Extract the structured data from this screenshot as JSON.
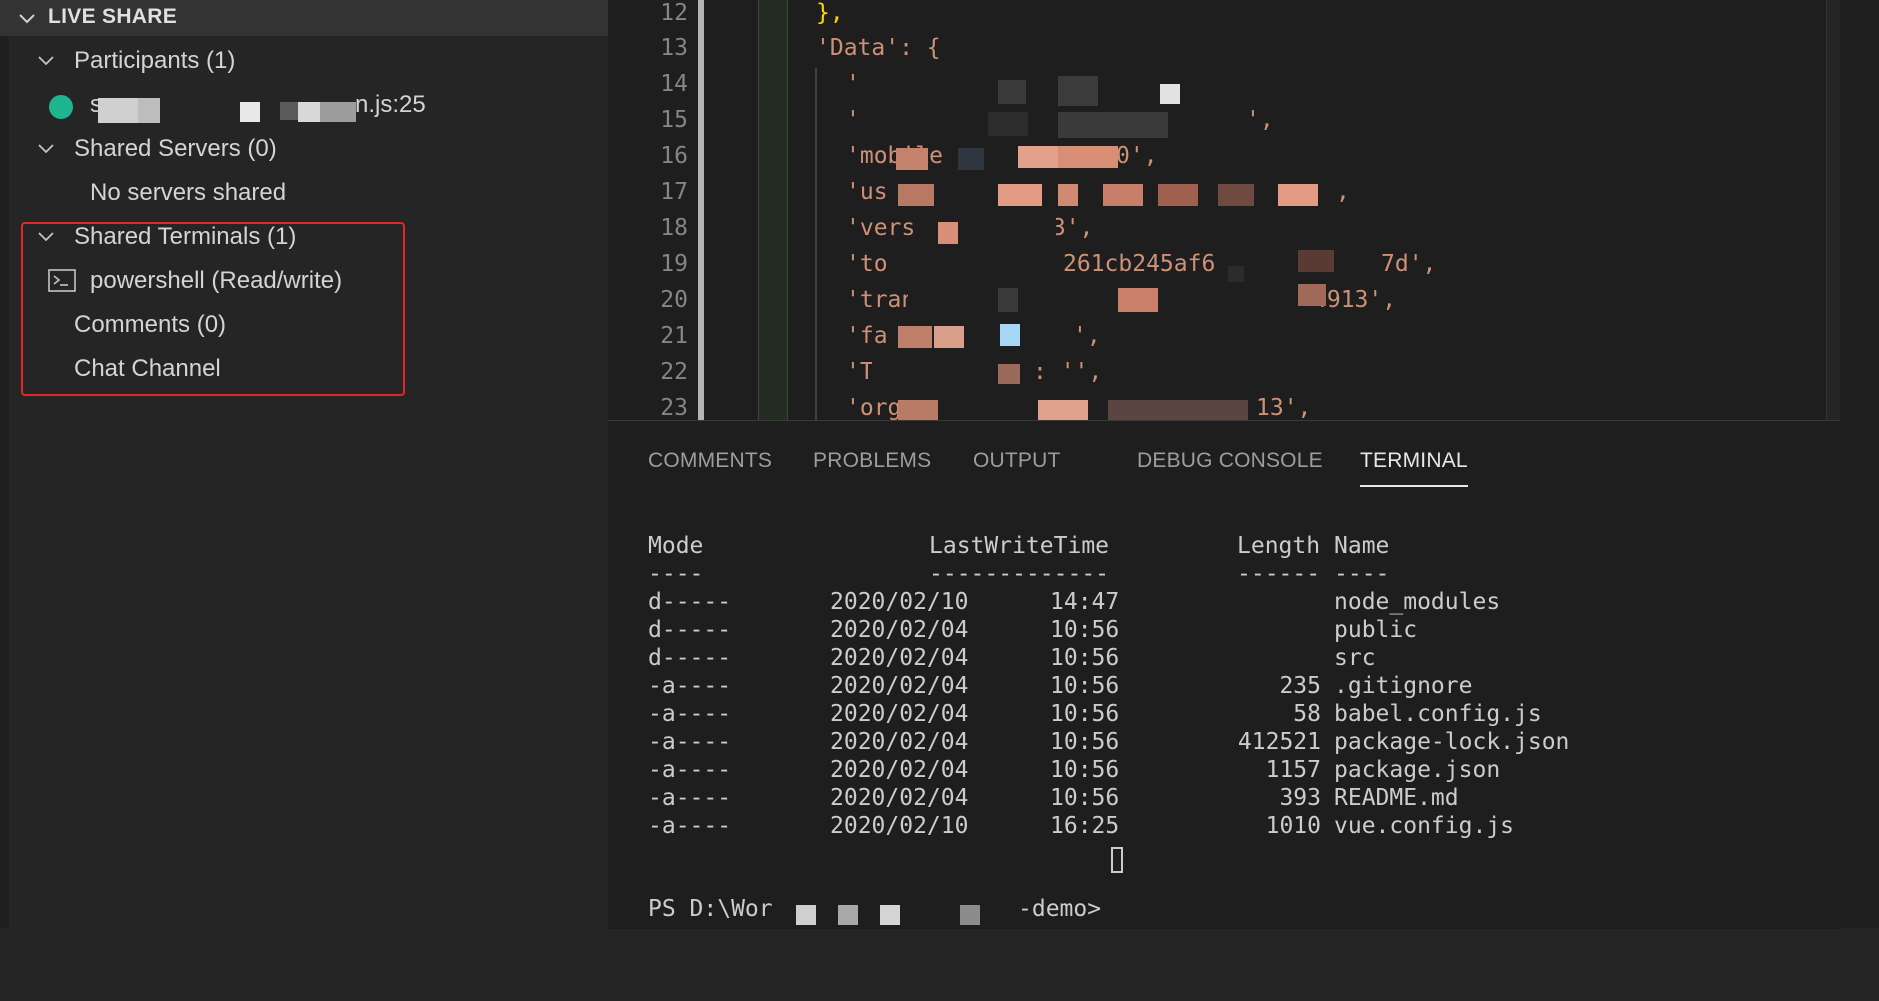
{
  "sidebar": {
    "section_title": "LIVE SHARE",
    "participants": {
      "header": "Participants (1)",
      "item_prefix": "s",
      "item_suffix": "n.js:25"
    },
    "servers": {
      "header": "Shared Servers (0)",
      "empty_text": "No servers shared"
    },
    "terminals": {
      "header": "Shared Terminals (1)",
      "item": "powershell (Read/write)"
    },
    "comments": "Comments (0)",
    "chat": "Chat Channel"
  },
  "editor": {
    "lines": [
      {
        "num": "12",
        "text": "},"
      },
      {
        "num": "13",
        "text": "'Data': {"
      },
      {
        "num": "14",
        "text": "'"
      },
      {
        "num": "15",
        "text": "'"
      },
      {
        "num": "16",
        "text": "'mobile"
      },
      {
        "num": "17",
        "text": "'us"
      },
      {
        "num": "18",
        "text": "'vers"
      },
      {
        "num": "19",
        "text": "'to"
      },
      {
        "num": "20",
        "text": "'tran"
      },
      {
        "num": "21",
        "text": "'fa"
      },
      {
        "num": "22",
        "text": "'T"
      },
      {
        "num": "23",
        "text": "'org"
      }
    ],
    "fragments": {
      "l15_end": "',",
      "l16_end": "0',",
      "l17_end": ",",
      "l18_end": "'3',",
      "l19_mid": "261cb245af6",
      "l19_end": "7d',",
      "l20_end": "4913',",
      "l21_end": "',",
      "l22_end": ": '',",
      "l23_end": "13',"
    }
  },
  "panel": {
    "tabs": [
      "COMMENTS",
      "PROBLEMS",
      "OUTPUT",
      "DEBUG CONSOLE",
      "TERMINAL"
    ],
    "active_tab": "TERMINAL",
    "terminal": {
      "headers": {
        "mode": "Mode",
        "time": "LastWriteTime",
        "length": "Length",
        "name": "Name"
      },
      "underlines": {
        "mode": "----",
        "time": "-------------",
        "length": "------",
        "name": "----"
      },
      "rows": [
        {
          "mode": "d-----",
          "date": "2020/02/10",
          "time": "14:47",
          "length": "",
          "name": "node_modules"
        },
        {
          "mode": "d-----",
          "date": "2020/02/04",
          "time": "10:56",
          "length": "",
          "name": "public"
        },
        {
          "mode": "d-----",
          "date": "2020/02/04",
          "time": "10:56",
          "length": "",
          "name": "src"
        },
        {
          "mode": "-a----",
          "date": "2020/02/04",
          "time": "10:56",
          "length": "235",
          "name": ".gitignore"
        },
        {
          "mode": "-a----",
          "date": "2020/02/04",
          "time": "10:56",
          "length": "58",
          "name": "babel.config.js"
        },
        {
          "mode": "-a----",
          "date": "2020/02/04",
          "time": "10:56",
          "length": "412521",
          "name": "package-lock.json"
        },
        {
          "mode": "-a----",
          "date": "2020/02/04",
          "time": "10:56",
          "length": "1157",
          "name": "package.json"
        },
        {
          "mode": "-a----",
          "date": "2020/02/04",
          "time": "10:56",
          "length": "393",
          "name": "README.md"
        },
        {
          "mode": "-a----",
          "date": "2020/02/10",
          "time": "16:25",
          "length": "1010",
          "name": "vue.config.js"
        }
      ],
      "prompt_start": "PS D:\\Wor",
      "prompt_end": "-demo>"
    }
  }
}
